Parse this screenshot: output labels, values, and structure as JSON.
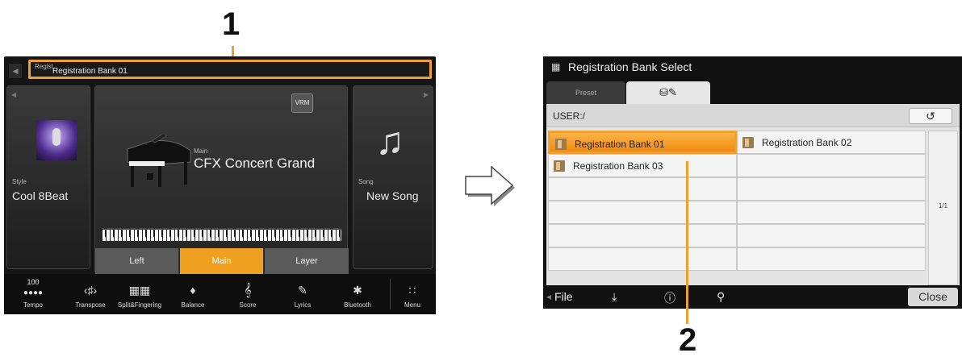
{
  "callouts": {
    "one": "1",
    "two": "2"
  },
  "left_screen": {
    "regist_tag": "Regist",
    "regist_bank": "Registration Bank 01",
    "style": {
      "label": "Style",
      "name": "Cool 8Beat"
    },
    "main": {
      "vrm": "VRM",
      "label": "Main",
      "voice": "CFX Concert Grand"
    },
    "song": {
      "label": "Song",
      "name": "New Song"
    },
    "parts": [
      "Left",
      "Main",
      "Layer"
    ],
    "active_part": "Main",
    "bottom": {
      "tempo_value": "100",
      "items": [
        {
          "label": "Tempo",
          "icon": "tempo-icon"
        },
        {
          "label": "Transpose",
          "icon": "transpose-icon"
        },
        {
          "label": "Split&Fingering",
          "icon": "split-icon"
        },
        {
          "label": "Balance",
          "icon": "balance-icon"
        },
        {
          "label": "Score",
          "icon": "score-icon"
        },
        {
          "label": "Lyrics",
          "icon": "lyrics-icon"
        },
        {
          "label": "Bluetooth",
          "icon": "bluetooth-icon"
        },
        {
          "label": "Menu",
          "icon": "menu-icon"
        }
      ]
    }
  },
  "right_screen": {
    "title": "Registration Bank Select",
    "tabs": {
      "preset": "Preset",
      "user": "⛁✎"
    },
    "path": "USER:/",
    "files": [
      {
        "name": "Registration Bank 01",
        "selected": true
      },
      {
        "name": "Registration Bank 02",
        "selected": false
      },
      {
        "name": "Registration Bank 03",
        "selected": false
      }
    ],
    "page": "1/1",
    "bottom": {
      "file": "File",
      "close": "Close"
    }
  },
  "colors": {
    "accent": "#f0a030",
    "active_part": "#f0a020"
  }
}
